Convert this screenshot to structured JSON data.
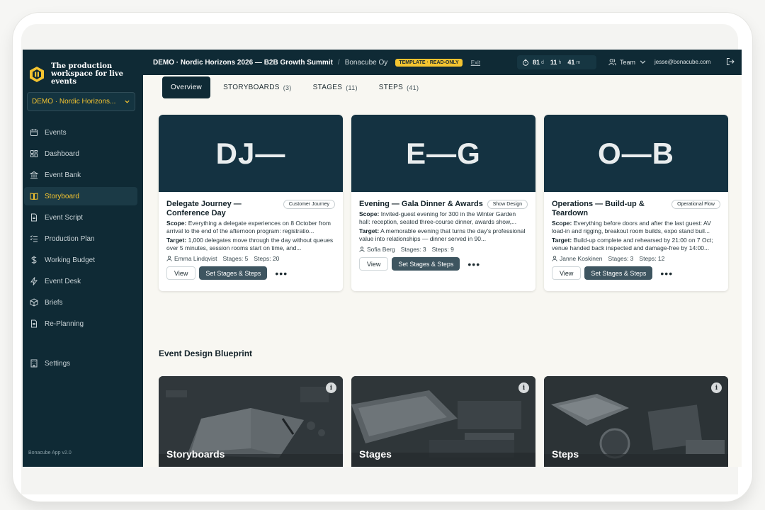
{
  "app": {
    "brand_text": "The production workspace for live events",
    "version": "Bonacube App v2.0",
    "event_selector": "DEMO · Nordic Horizons..."
  },
  "sidebar": {
    "items": [
      {
        "label": "Events",
        "icon": "calendar-icon"
      },
      {
        "label": "Dashboard",
        "icon": "grid-icon"
      },
      {
        "label": "Event Bank",
        "icon": "bank-icon"
      },
      {
        "label": "Storyboard",
        "icon": "book-icon",
        "active": true
      },
      {
        "label": "Event Script",
        "icon": "document-icon"
      },
      {
        "label": "Production Plan",
        "icon": "list-icon"
      },
      {
        "label": "Working Budget",
        "icon": "dollar-icon"
      },
      {
        "label": "Event Desk",
        "icon": "lightning-icon"
      },
      {
        "label": "Briefs",
        "icon": "box-icon"
      },
      {
        "label": "Re-Planning",
        "icon": "document-icon"
      }
    ],
    "settings": "Settings"
  },
  "topbar": {
    "title": "DEMO · Nordic Horizons 2026 — B2B Growth Summit",
    "org": "Bonacube Oy",
    "badge": "TEMPLATE · READ-ONLY",
    "exit": "Exit",
    "timer": {
      "days": "81",
      "days_unit": "d",
      "hours": "11",
      "hours_unit": "h",
      "minutes": "41",
      "minutes_unit": "m"
    },
    "team": "Team",
    "email": "jesse@bonacube.com"
  },
  "tabs": [
    {
      "label": "Overview",
      "count": "",
      "active": true
    },
    {
      "label": "STORYBOARDS",
      "count": "(3)"
    },
    {
      "label": "STAGES",
      "count": "(11)"
    },
    {
      "label": "STEPS",
      "count": "(41)"
    }
  ],
  "cards": [
    {
      "initials": "DJ—",
      "title": "Delegate Journey — Conference Day",
      "tag": "Customer Journey",
      "scope_label": "Scope:",
      "scope": "Everything a delegate experiences on 8 October from arrival to the end of the afternoon program: registratio...",
      "target_label": "Target:",
      "target": "1,000 delegates move through the day without queues over 5 minutes, session rooms start on time, and...",
      "owner": "Emma Lindqvist",
      "stages": "Stages: 5",
      "steps": "Steps: 20",
      "view": "View",
      "set": "Set Stages & Steps"
    },
    {
      "initials": "E—G",
      "title": "Evening — Gala Dinner & Awards",
      "tag": "Show Design",
      "scope_label": "Scope:",
      "scope": "Invited-guest evening for 300 in the Winter Garden hall: reception, seated three-course dinner, awards show,...",
      "target_label": "Target:",
      "target": "A memorable evening that turns the day's professional value into relationships — dinner served in 90...",
      "owner": "Sofia Berg",
      "stages": "Stages: 3",
      "steps": "Steps: 9",
      "view": "View",
      "set": "Set Stages & Steps"
    },
    {
      "initials": "O—B",
      "title": "Operations — Build-up & Teardown",
      "tag": "Operational Flow",
      "scope_label": "Scope:",
      "scope": "Everything before doors and after the last guest: AV load-in and rigging, breakout room builds, expo stand buil...",
      "target_label": "Target:",
      "target": "Build-up complete and rehearsed by 21:00 on 7 Oct; venue handed back inspected and damage-free by 14:00...",
      "owner": "Janne Koskinen",
      "stages": "Stages: 3",
      "steps": "Steps: 12",
      "view": "View",
      "set": "Set Stages & Steps"
    }
  ],
  "blueprint": {
    "title": "Event Design Blueprint",
    "tiles": [
      {
        "label": "Storyboards",
        "info": "i"
      },
      {
        "label": "Stages",
        "info": "i"
      },
      {
        "label": "Steps",
        "info": "i"
      }
    ]
  },
  "colors": {
    "sidebar_bg": "#0f2a35",
    "accent": "#f4c430",
    "card_header": "#143241",
    "button_dark": "#3e5560"
  }
}
